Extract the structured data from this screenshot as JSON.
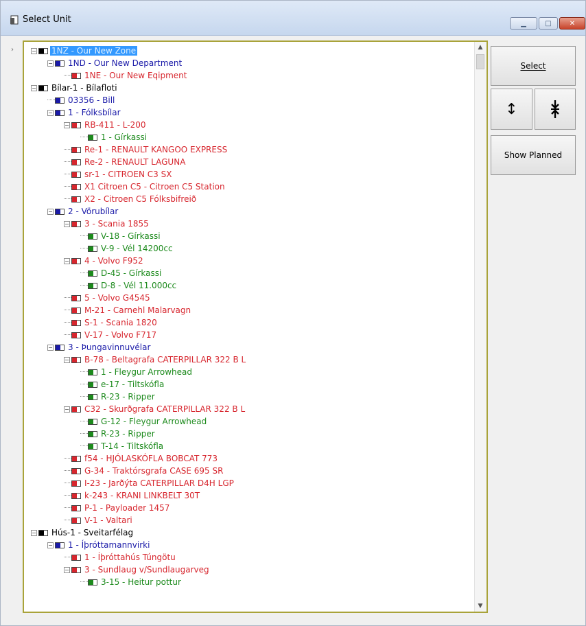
{
  "window": {
    "title": "Select Unit",
    "icons": {
      "app": "document-icon",
      "minimize": "minimize-icon",
      "maximize": "maximize-icon",
      "close": "close-icon"
    }
  },
  "buttons": {
    "select": "Select",
    "show_planned": "Show Planned",
    "expand_icon": "expand-all-icon",
    "collapse_icon": "collapse-all-icon"
  },
  "colors": {
    "zone": "#000000",
    "department": "#1a1aa8",
    "equipment": "#d7262e",
    "component": "#1c8a1c",
    "selection": "#3399ff",
    "frame": "#a9a33a"
  },
  "tree": [
    {
      "level": 0,
      "exp": "-",
      "color": "black",
      "fill": "#000000",
      "label": "1NZ - Our New Zone",
      "selected": true
    },
    {
      "level": 1,
      "exp": "-",
      "color": "blue",
      "fill": "#1a1aa8",
      "label": "1ND - Our New Department"
    },
    {
      "level": 2,
      "exp": "",
      "color": "red",
      "fill": "#d7262e",
      "label": "1NE - Our New Eqipment"
    },
    {
      "level": 0,
      "exp": "-",
      "color": "black",
      "fill": "#000000",
      "label": "Bílar-1 - Bílafloti"
    },
    {
      "level": 1,
      "exp": "",
      "color": "blue",
      "fill": "#1a1aa8",
      "label": "03356 - Bill"
    },
    {
      "level": 1,
      "exp": "-",
      "color": "blue",
      "fill": "#1a1aa8",
      "label": "1 - Fólksbílar"
    },
    {
      "level": 2,
      "exp": "-",
      "color": "red",
      "fill": "#d7262e",
      "label": "RB-411 - L-200"
    },
    {
      "level": 3,
      "exp": "",
      "color": "green",
      "fill": "#1c8a1c",
      "label": "1 - Gírkassi"
    },
    {
      "level": 2,
      "exp": "",
      "color": "red",
      "fill": "#d7262e",
      "label": "Re-1 - RENAULT KANGOO EXPRESS"
    },
    {
      "level": 2,
      "exp": "",
      "color": "red",
      "fill": "#d7262e",
      "label": "Re-2 - RENAULT LAGUNA"
    },
    {
      "level": 2,
      "exp": "",
      "color": "red",
      "fill": "#d7262e",
      "label": "sr-1 - CITROEN C3 SX"
    },
    {
      "level": 2,
      "exp": "",
      "color": "red",
      "fill": "#d7262e",
      "label": "X1  Citroen C5 - Citroen C5  Station"
    },
    {
      "level": 2,
      "exp": "",
      "color": "red",
      "fill": "#d7262e",
      "label": "X2 - Citroen C5   Fólksbifreið"
    },
    {
      "level": 1,
      "exp": "-",
      "color": "blue",
      "fill": "#1a1aa8",
      "label": "2 - Vörubílar"
    },
    {
      "level": 2,
      "exp": "-",
      "color": "red",
      "fill": "#d7262e",
      "label": "3 - Scania 1855"
    },
    {
      "level": 3,
      "exp": "",
      "color": "green",
      "fill": "#1c8a1c",
      "label": "V-18 - Gírkassi"
    },
    {
      "level": 3,
      "exp": "",
      "color": "green",
      "fill": "#1c8a1c",
      "label": "V-9 - Vél 14200cc"
    },
    {
      "level": 2,
      "exp": "-",
      "color": "red",
      "fill": "#d7262e",
      "label": "4 - Volvo F952"
    },
    {
      "level": 3,
      "exp": "",
      "color": "green",
      "fill": "#1c8a1c",
      "label": "D-45 - Gírkassi"
    },
    {
      "level": 3,
      "exp": "",
      "color": "green",
      "fill": "#1c8a1c",
      "label": "D-8 - Vél 11.000cc"
    },
    {
      "level": 2,
      "exp": "",
      "color": "red",
      "fill": "#d7262e",
      "label": "5 - Volvo G4545"
    },
    {
      "level": 2,
      "exp": "",
      "color": "red",
      "fill": "#d7262e",
      "label": "M-21 - Carnehl Malarvagn"
    },
    {
      "level": 2,
      "exp": "",
      "color": "red",
      "fill": "#d7262e",
      "label": "S-1 - Scania 1820"
    },
    {
      "level": 2,
      "exp": "",
      "color": "red",
      "fill": "#d7262e",
      "label": "V-17 - Volvo F717"
    },
    {
      "level": 1,
      "exp": "-",
      "color": "blue",
      "fill": "#1a1aa8",
      "label": "3 - Þungavinnuvélar"
    },
    {
      "level": 2,
      "exp": "-",
      "color": "red",
      "fill": "#d7262e",
      "label": "B-78 - Beltagrafa CATERPILLAR 322 B L"
    },
    {
      "level": 3,
      "exp": "",
      "color": "green",
      "fill": "#1c8a1c",
      "label": "1 - Fleygur Arrowhead"
    },
    {
      "level": 3,
      "exp": "",
      "color": "green",
      "fill": "#1c8a1c",
      "label": "e-17 - Tiltskófla"
    },
    {
      "level": 3,
      "exp": "",
      "color": "green",
      "fill": "#1c8a1c",
      "label": "R-23 - Ripper"
    },
    {
      "level": 2,
      "exp": "-",
      "color": "red",
      "fill": "#d7262e",
      "label": "C32 - Skurðgrafa CATERPILLAR 322 B L"
    },
    {
      "level": 3,
      "exp": "",
      "color": "green",
      "fill": "#1c8a1c",
      "label": "G-12 - Fleygur Arrowhead"
    },
    {
      "level": 3,
      "exp": "",
      "color": "green",
      "fill": "#1c8a1c",
      "label": "R-23 - Ripper"
    },
    {
      "level": 3,
      "exp": "",
      "color": "green",
      "fill": "#1c8a1c",
      "label": "T-14 - Tiltskófla"
    },
    {
      "level": 2,
      "exp": "",
      "color": "red",
      "fill": "#d7262e",
      "label": "f54 - HJÓLASKÓFLA BOBCAT 773"
    },
    {
      "level": 2,
      "exp": "",
      "color": "red",
      "fill": "#d7262e",
      "label": "G-34 - Traktórsgrafa CASE 695 SR"
    },
    {
      "level": 2,
      "exp": "",
      "color": "red",
      "fill": "#d7262e",
      "label": "I-23 - Jarðýta CATERPILLAR D4H LGP"
    },
    {
      "level": 2,
      "exp": "",
      "color": "red",
      "fill": "#d7262e",
      "label": "k-243 - KRANI LINKBELT 30T"
    },
    {
      "level": 2,
      "exp": "",
      "color": "red",
      "fill": "#d7262e",
      "label": "P-1 - Payloader 1457"
    },
    {
      "level": 2,
      "exp": "",
      "color": "red",
      "fill": "#d7262e",
      "label": "V-1 - Valtari"
    },
    {
      "level": 0,
      "exp": "-",
      "color": "black",
      "fill": "#000000",
      "label": "Hús-1 - Sveitarfélag"
    },
    {
      "level": 1,
      "exp": "-",
      "color": "blue",
      "fill": "#1a1aa8",
      "label": "1 - Íþróttamannvirki"
    },
    {
      "level": 2,
      "exp": "",
      "color": "red",
      "fill": "#d7262e",
      "label": "1 - Íþróttahús Túngötu"
    },
    {
      "level": 2,
      "exp": "-",
      "color": "red",
      "fill": "#d7262e",
      "label": "3 - Sundlaug v/Sundlaugarveg"
    },
    {
      "level": 3,
      "exp": "",
      "color": "green",
      "fill": "#1c8a1c",
      "label": "3-15 - Heitur pottur"
    }
  ]
}
